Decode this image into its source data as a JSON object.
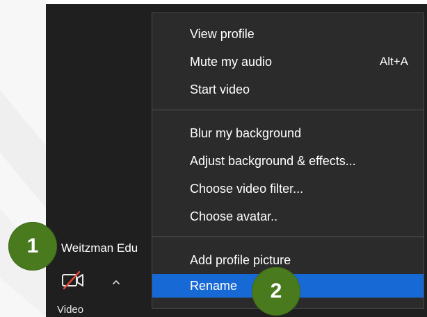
{
  "participant": {
    "name": "Weitzman Edu"
  },
  "toolbar": {
    "video_label": "Video"
  },
  "menu": {
    "items": [
      {
        "label": "View profile"
      },
      {
        "label": "Mute my audio",
        "shortcut": "Alt+A"
      },
      {
        "label": "Start video"
      },
      {
        "label": "Blur my background"
      },
      {
        "label": "Adjust background & effects..."
      },
      {
        "label": "Choose video filter..."
      },
      {
        "label": "Choose avatar.."
      },
      {
        "label": "Add profile picture"
      },
      {
        "label": "Rename"
      }
    ],
    "selected_item": "Rename"
  },
  "annotations": [
    "1",
    "2"
  ],
  "colors": {
    "window_bg": "#1f1f1f",
    "menu_bg": "#2b2b2b",
    "selection": "#1769d6",
    "badge": "#4a7a1e",
    "video_off_slash": "#e0453a"
  }
}
